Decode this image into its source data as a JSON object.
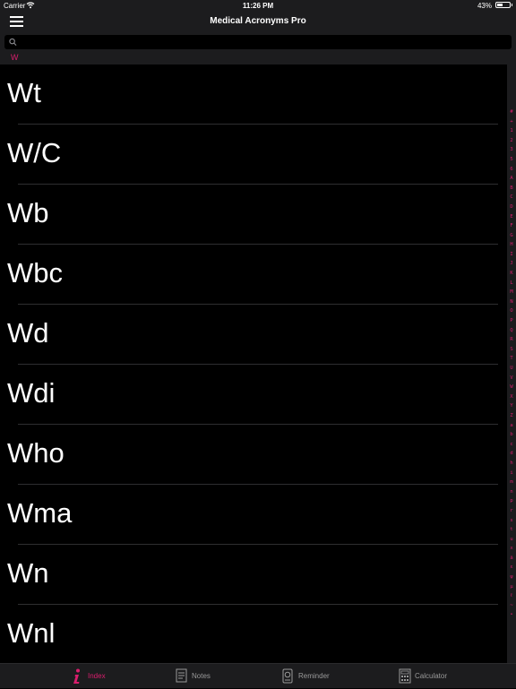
{
  "status_bar": {
    "carrier": "Carrier",
    "time": "11:26 PM",
    "battery": "43%"
  },
  "nav": {
    "title": "Medical Acronyms Pro"
  },
  "search": {
    "placeholder": "",
    "value": ""
  },
  "section": {
    "letter": "W"
  },
  "rows": [
    "Wt",
    "W/C",
    "Wb",
    "Wbc",
    "Wd",
    "Wdi",
    "Who",
    "Wma",
    "Wn",
    "Wnl"
  ],
  "index": [
    "#",
    "+",
    "1",
    "2",
    "3",
    "5",
    "6",
    "A",
    "B",
    "C",
    "D",
    "E",
    "F",
    "G",
    "H",
    "I",
    "J",
    "K",
    "L",
    "M",
    "N",
    "O",
    "P",
    "Q",
    "R",
    "S",
    "T",
    "U",
    "V",
    "W",
    "X",
    "Y",
    "Z",
    "a",
    "b",
    "c",
    "d",
    "h",
    "i",
    "m",
    "n",
    "p",
    "r",
    "s",
    "t",
    "u",
    "x",
    "ā",
    "ε",
    "ψ",
    "μ",
    "ℓ",
    "~",
    "•"
  ],
  "tabs": [
    {
      "label": "Index",
      "icon": "info-icon",
      "active": true
    },
    {
      "label": "Notes",
      "icon": "notes-icon",
      "active": false
    },
    {
      "label": "Reminder",
      "icon": "reminder-icon",
      "active": false
    },
    {
      "label": "Calculator",
      "icon": "calculator-icon",
      "active": false
    }
  ],
  "colors": {
    "accent": "#d91e6d",
    "background": "#000000",
    "bar": "#1c1c1e"
  }
}
